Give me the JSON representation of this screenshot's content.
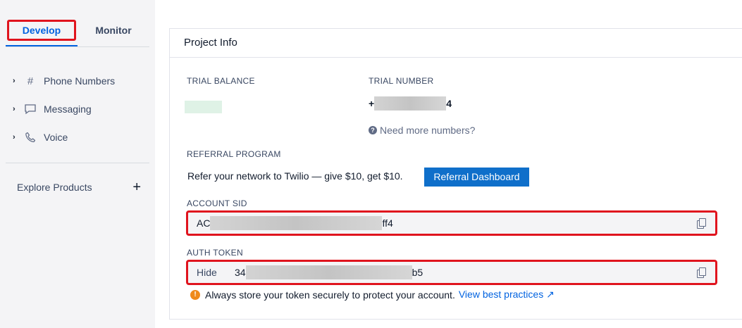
{
  "sidebar": {
    "tabs": [
      {
        "label": "Develop",
        "active": true
      },
      {
        "label": "Monitor",
        "active": false
      }
    ],
    "nav_items": [
      {
        "label": "Phone Numbers",
        "icon": "hash-icon"
      },
      {
        "label": "Messaging",
        "icon": "chat-icon"
      },
      {
        "label": "Voice",
        "icon": "phone-icon"
      }
    ],
    "explore_label": "Explore Products"
  },
  "project_info": {
    "title": "Project Info",
    "trial_balance_label": "TRIAL BALANCE",
    "trial_number_label": "TRIAL NUMBER",
    "trial_number_prefix": "+",
    "trial_number_suffix": "4",
    "need_more": "Need more numbers?",
    "referral_label": "REFERRAL PROGRAM",
    "referral_text": "Refer your network to Twilio — give $10, get $10.",
    "referral_button": "Referral Dashboard",
    "account_sid_label": "ACCOUNT SID",
    "account_sid_prefix": "AC",
    "account_sid_suffix": "ff4",
    "auth_token_label": "AUTH TOKEN",
    "hide_label": "Hide",
    "auth_token_prefix": "34",
    "auth_token_suffix": "b5",
    "warning_text": "Always store your token securely to protect your account.",
    "best_practices_link": "View best practices ↗"
  },
  "colors": {
    "accent_blue": "#0263e0",
    "button_blue": "#0f6fca",
    "highlight_red": "#e0141e",
    "warning_orange": "#ef8a1a"
  }
}
